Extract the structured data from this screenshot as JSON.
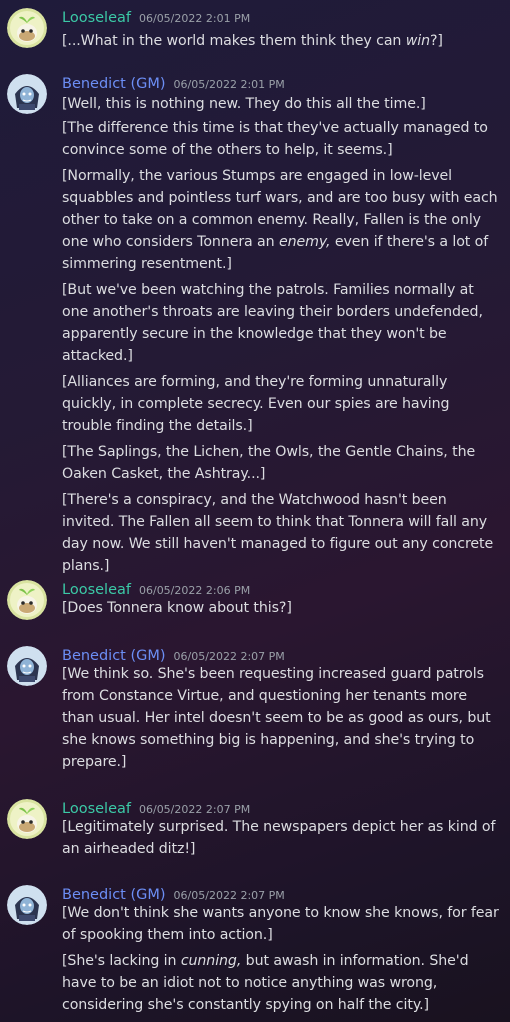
{
  "messages": [
    {
      "author": "Looseleaf",
      "timestamp": "06/05/2022 2:01 PM",
      "lines": [
        [
          "[...What in the world makes them think they can ",
          "win",
          "?]"
        ]
      ]
    },
    {
      "author": "Benedict (GM)",
      "timestamp": "06/05/2022 2:01 PM",
      "lines": [
        [
          "[Well, this is nothing new. They do this all the time.]"
        ],
        [
          "[The difference this time is that they've actually managed to convince some of the others to help, it seems.]"
        ],
        [
          "[Normally, the various Stumps are engaged in low-level squabbles and pointless turf wars, and are too busy with each other to take on a common enemy. Really, Fallen is the only one who considers Tonnera an ",
          "enemy,",
          " even if there's a lot of simmering resentment.]"
        ],
        [
          "[But we've been watching the patrols. Families normally at one another's throats are leaving their borders undefended, apparently secure in the knowledge that they won't be attacked.]"
        ],
        [
          "[Alliances are forming, and they're forming unnaturally quickly, in complete secrecy. Even our spies are having trouble finding the details.]"
        ],
        [
          "[The Saplings, the Lichen, the Owls, the Gentle Chains, the Oaken Casket, the Ashtray...]"
        ],
        [
          "[There's a conspiracy, and the Watchwood hasn't been invited. The Fallen all seem to think that Tonnera will fall any day now. We still haven't managed to figure out any concrete plans.]"
        ]
      ]
    },
    {
      "author": "Looseleaf",
      "timestamp": "06/05/2022 2:06 PM",
      "lines": [
        [
          "[Does Tonnera know about this?]"
        ]
      ]
    },
    {
      "author": "Benedict (GM)",
      "timestamp": "06/05/2022 2:07 PM",
      "lines": [
        [
          "[We think so. She's been requesting increased guard patrols from Constance Virtue, and questioning her tenants more than usual. Her intel doesn't seem to be as good as ours, but she knows something big is happening, and she's trying to prepare.]"
        ]
      ]
    },
    {
      "author": "Looseleaf",
      "timestamp": "06/05/2022 2:07 PM",
      "lines": [
        [
          "[Legitimately surprised. The newspapers depict her as kind of an airheaded ditz!]"
        ]
      ]
    },
    {
      "author": "Benedict (GM)",
      "timestamp": "06/05/2022 2:07 PM",
      "lines": [
        [
          "[We don't think she wants anyone to know she knows, for fear of spooking them into action.]"
        ],
        [
          "[She's lacking in ",
          "cunning,",
          " but awash in information. She'd have to be an idiot not to notice anything was wrong, considering she's constantly spying on half the city.]"
        ]
      ]
    }
  ],
  "colors": {
    "looseleaf_name": "#3bc9a6",
    "gm_name": "#6c8ef5",
    "timestamp": "#9aa0a8",
    "text": "#dcdde1"
  },
  "icons": {
    "looseleaf_avatar": "seedling-avatar-icon",
    "gm_avatar": "hooded-figure-avatar-icon"
  }
}
